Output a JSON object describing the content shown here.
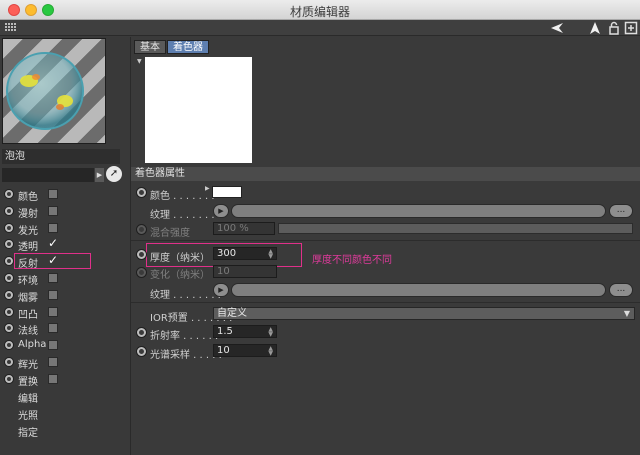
{
  "window": {
    "title": "材质编辑器"
  },
  "toolbar": {
    "icons": [
      "grid-icon",
      "arrow-left-icon",
      "arrow-up-icon",
      "lock-icon",
      "new-window-icon"
    ]
  },
  "material": {
    "name": "泡泡"
  },
  "channels": [
    {
      "label": "颜色",
      "checked": false
    },
    {
      "label": "漫射",
      "checked": false
    },
    {
      "label": "发光",
      "checked": false
    },
    {
      "label": "透明",
      "checked": true
    },
    {
      "label": "反射",
      "checked": true
    },
    {
      "label": "环境",
      "checked": false
    },
    {
      "label": "烟雾",
      "checked": false
    },
    {
      "label": "凹凸",
      "checked": false
    },
    {
      "label": "法线",
      "checked": false
    },
    {
      "label": "Alpha",
      "checked": false
    },
    {
      "label": "辉光",
      "checked": false
    },
    {
      "label": "置换",
      "checked": false
    }
  ],
  "extra_items": [
    "编辑",
    "光照",
    "指定"
  ],
  "tabs": {
    "basic": "基本",
    "shader": "着色器"
  },
  "section_title": "着色器属性",
  "color_row": {
    "label": "颜色 . . . . . . ."
  },
  "texture_row": {
    "label": "纹理 . . . . . . . .",
    "button": "..."
  },
  "mix_row": {
    "label": "混合强度",
    "value": "100 %"
  },
  "thickness_row": {
    "label": "厚度（纳米）",
    "value": "300"
  },
  "variation_row": {
    "label": "变化（纳米）",
    "value": "10"
  },
  "texture_row2": {
    "label": "纹理 . . . . . . . .",
    "button": "..."
  },
  "annotation": "厚度不同颜色不同",
  "ior_row": {
    "label": "IOR预置 . . . . . . .",
    "value": "自定义"
  },
  "refraction_row": {
    "label": "折射率 . . . . . .",
    "value": "1.5"
  },
  "spectral_row": {
    "label": "光谱采样 . . . . .",
    "value": "10"
  },
  "colors": {
    "accent_tab": "#5e7fb0",
    "highlight": "#e0308a"
  }
}
